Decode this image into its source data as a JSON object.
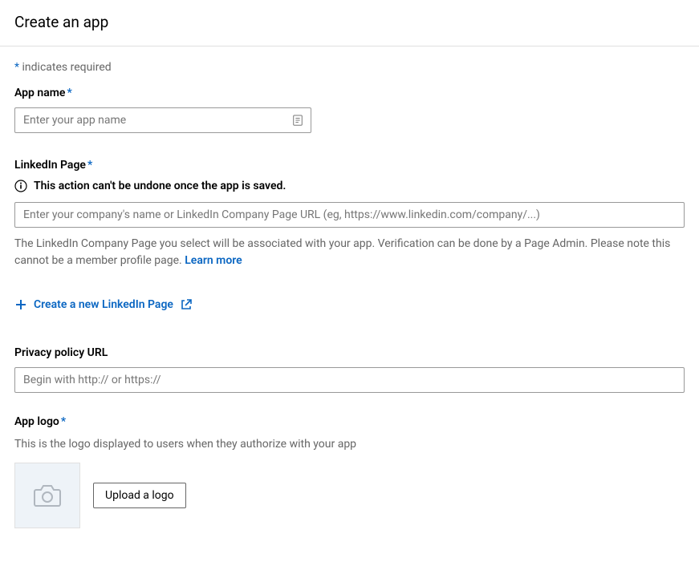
{
  "header": {
    "title": "Create an app"
  },
  "requiredNote": {
    "asterisk": "*",
    "text": " indicates required"
  },
  "appName": {
    "label": "App name",
    "asterisk": "*",
    "placeholder": "Enter your app name"
  },
  "linkedinPage": {
    "label": "LinkedIn Page",
    "asterisk": "*",
    "infoText": "This action can't be undone once the app is saved.",
    "placeholder": "Enter your company's name or LinkedIn Company Page URL (eg, https://www.linkedin.com/company/...)",
    "helperText": "The LinkedIn Company Page you select will be associated with your app. Verification can be done by a Page Admin. Please note this cannot be a member profile page. ",
    "learnMore": "Learn more",
    "createPage": "Create a new LinkedIn Page"
  },
  "privacyPolicy": {
    "label": "Privacy policy URL",
    "placeholder": "Begin with http:// or https://"
  },
  "appLogo": {
    "label": "App logo",
    "asterisk": "*",
    "helperText": "This is the logo displayed to users when they authorize with your app",
    "uploadButton": "Upload a logo"
  }
}
